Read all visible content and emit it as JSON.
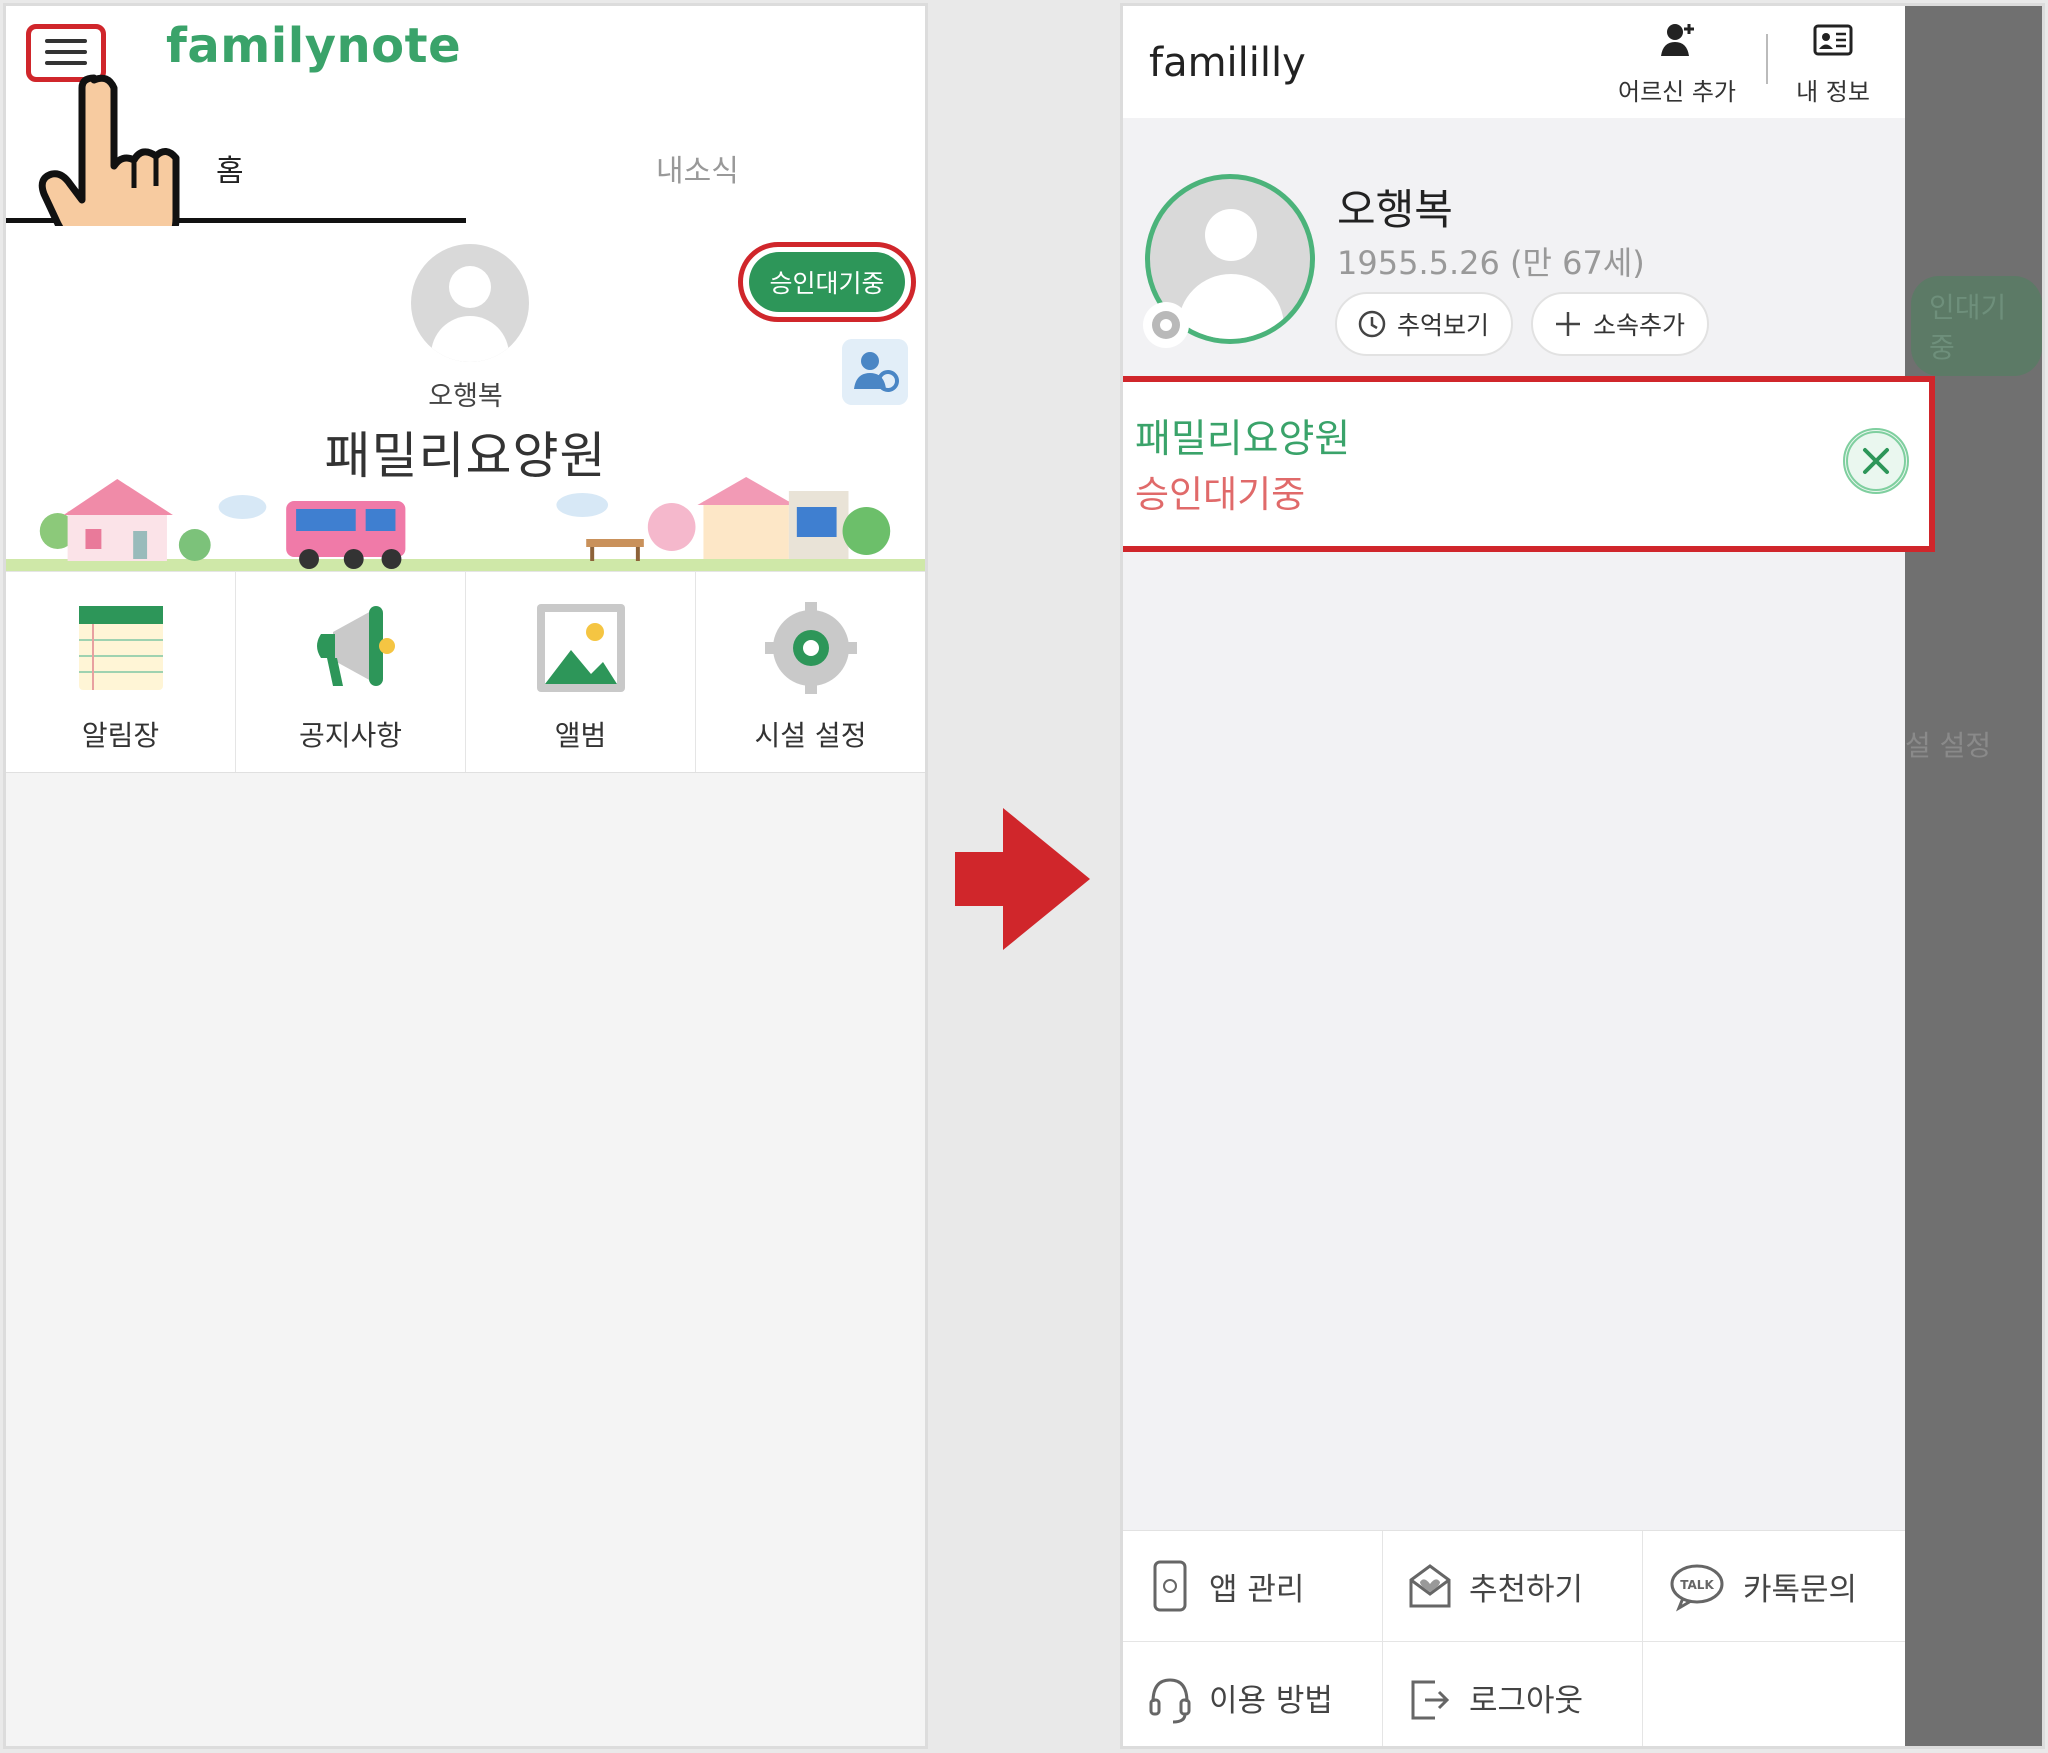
{
  "left": {
    "brand": "familynote",
    "tabs": [
      {
        "label": "홈"
      },
      {
        "label": "내소식"
      }
    ],
    "pending_badge": "승인대기중",
    "resident_name": "오행복",
    "facility_name": "패밀리요양원",
    "menu": [
      {
        "label": "알림장",
        "icon": "notebook-icon"
      },
      {
        "label": "공지사항",
        "icon": "megaphone-icon"
      },
      {
        "label": "앨범",
        "icon": "album-icon"
      },
      {
        "label": "시설 설정",
        "icon": "gear-icon"
      }
    ]
  },
  "right": {
    "brand": "famililly",
    "top_buttons": {
      "add_elder": "어르신 추가",
      "my_info": "내 정보"
    },
    "resident": {
      "name": "오행복",
      "dob": "1955.5.26 (만 67세)"
    },
    "chips": {
      "memories": "추억보기",
      "add_affiliation": "소속추가"
    },
    "facility_card": {
      "name": "패밀리요양원",
      "status": "승인대기중"
    },
    "bottom_menu": {
      "app_manage": "앱 관리",
      "recommend": "추천하기",
      "kakao": "카톡문의",
      "how_to": "이용 방법",
      "logout": "로그아웃"
    },
    "background_peek": {
      "pending": "인대기중",
      "settings": "설 설정"
    }
  },
  "colors": {
    "accent_green": "#3aa36a",
    "highlight_red": "#d0262b",
    "pending_pink": "#e06a6a"
  }
}
